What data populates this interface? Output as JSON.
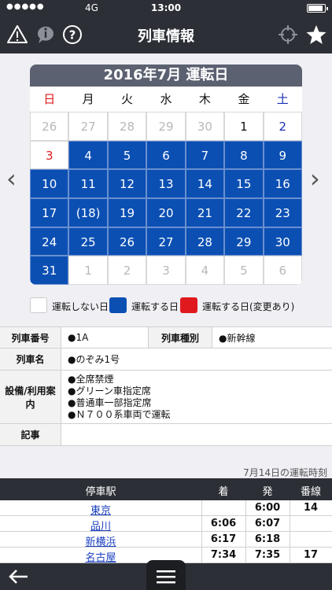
{
  "status_bar": {
    "signal": "●●●●●",
    "network": "4G",
    "time": "13:00",
    "battery_level": 0.9
  },
  "nav": {
    "title": "列車情報",
    "icons": [
      "warning-icon",
      "info-icon",
      "help-icon",
      "crosshair-icon",
      "star-icon"
    ]
  },
  "calendar": {
    "title": "2016年7月 運転日",
    "weekdays": [
      {
        "label": "日",
        "color": "#e0191e"
      },
      {
        "label": "月",
        "color": "#111111"
      },
      {
        "label": "火",
        "color": "#111111"
      },
      {
        "label": "水",
        "color": "#111111"
      },
      {
        "label": "木",
        "color": "#111111"
      },
      {
        "label": "金",
        "color": "#111111"
      },
      {
        "label": "土",
        "color": "#1a2fb5"
      }
    ],
    "days": [
      {
        "label": "26",
        "state": "muted"
      },
      {
        "label": "27",
        "state": "muted"
      },
      {
        "label": "28",
        "state": "muted"
      },
      {
        "label": "29",
        "state": "muted"
      },
      {
        "label": "30",
        "state": "muted"
      },
      {
        "label": "1",
        "state": "none"
      },
      {
        "label": "2",
        "state": "none",
        "color": "#1a2fb5"
      },
      {
        "label": "3",
        "state": "none",
        "color": "#e0191e"
      },
      {
        "label": "4",
        "state": "run"
      },
      {
        "label": "5",
        "state": "run"
      },
      {
        "label": "6",
        "state": "run"
      },
      {
        "label": "7",
        "state": "run"
      },
      {
        "label": "8",
        "state": "run"
      },
      {
        "label": "9",
        "state": "run"
      },
      {
        "label": "10",
        "state": "run"
      },
      {
        "label": "11",
        "state": "run"
      },
      {
        "label": "12",
        "state": "run"
      },
      {
        "label": "13",
        "state": "run"
      },
      {
        "label": "14",
        "state": "run"
      },
      {
        "label": "15",
        "state": "run"
      },
      {
        "label": "16",
        "state": "run"
      },
      {
        "label": "17",
        "state": "run"
      },
      {
        "label": "(18)",
        "state": "run"
      },
      {
        "label": "19",
        "state": "run"
      },
      {
        "label": "20",
        "state": "run"
      },
      {
        "label": "21",
        "state": "run"
      },
      {
        "label": "22",
        "state": "run"
      },
      {
        "label": "23",
        "state": "run"
      },
      {
        "label": "24",
        "state": "run"
      },
      {
        "label": "25",
        "state": "run"
      },
      {
        "label": "26",
        "state": "run"
      },
      {
        "label": "27",
        "state": "run"
      },
      {
        "label": "28",
        "state": "run"
      },
      {
        "label": "29",
        "state": "run"
      },
      {
        "label": "30",
        "state": "run"
      },
      {
        "label": "31",
        "state": "run"
      },
      {
        "label": "1",
        "state": "muted"
      },
      {
        "label": "2",
        "state": "muted"
      },
      {
        "label": "3",
        "state": "muted"
      },
      {
        "label": "4",
        "state": "muted"
      },
      {
        "label": "5",
        "state": "muted"
      },
      {
        "label": "6",
        "state": "muted"
      }
    ],
    "prev_arrow": "‹",
    "next_arrow": "›"
  },
  "legend": [
    {
      "color": "#ffffff",
      "label": "運転しない日"
    },
    {
      "color": "#0b4fb3",
      "label": "運転する日"
    },
    {
      "color": "#e0191e",
      "label": "運転する日(変更あり)"
    }
  ],
  "info": {
    "train_no_label": "列車番号",
    "train_no": "●1A",
    "train_type_label": "列車種別",
    "train_type": "●新幹線",
    "train_name_label": "列車名",
    "train_name": "●のぞみ1号",
    "facilities_label": "設備/利用案内",
    "facilities": [
      "●全席禁煙",
      "●グリーン車指定席",
      "●普通車一部指定席",
      "●Ｎ７００系車両で運転"
    ],
    "notes_label": "記事",
    "notes": ""
  },
  "timetable": {
    "caption": "7月14日の運転時刻",
    "headers": {
      "station": "停車駅",
      "arrive": "着",
      "depart": "発",
      "track": "番線"
    },
    "rows": [
      {
        "station": "東京",
        "arrive": "",
        "depart": "6:00",
        "track": "14"
      },
      {
        "station": "品川",
        "arrive": "6:06",
        "depart": "6:07",
        "track": ""
      },
      {
        "station": "新横浜",
        "arrive": "6:17",
        "depart": "6:18",
        "track": ""
      },
      {
        "station": "名古屋",
        "arrive": "7:34",
        "depart": "7:35",
        "track": "17"
      }
    ]
  }
}
